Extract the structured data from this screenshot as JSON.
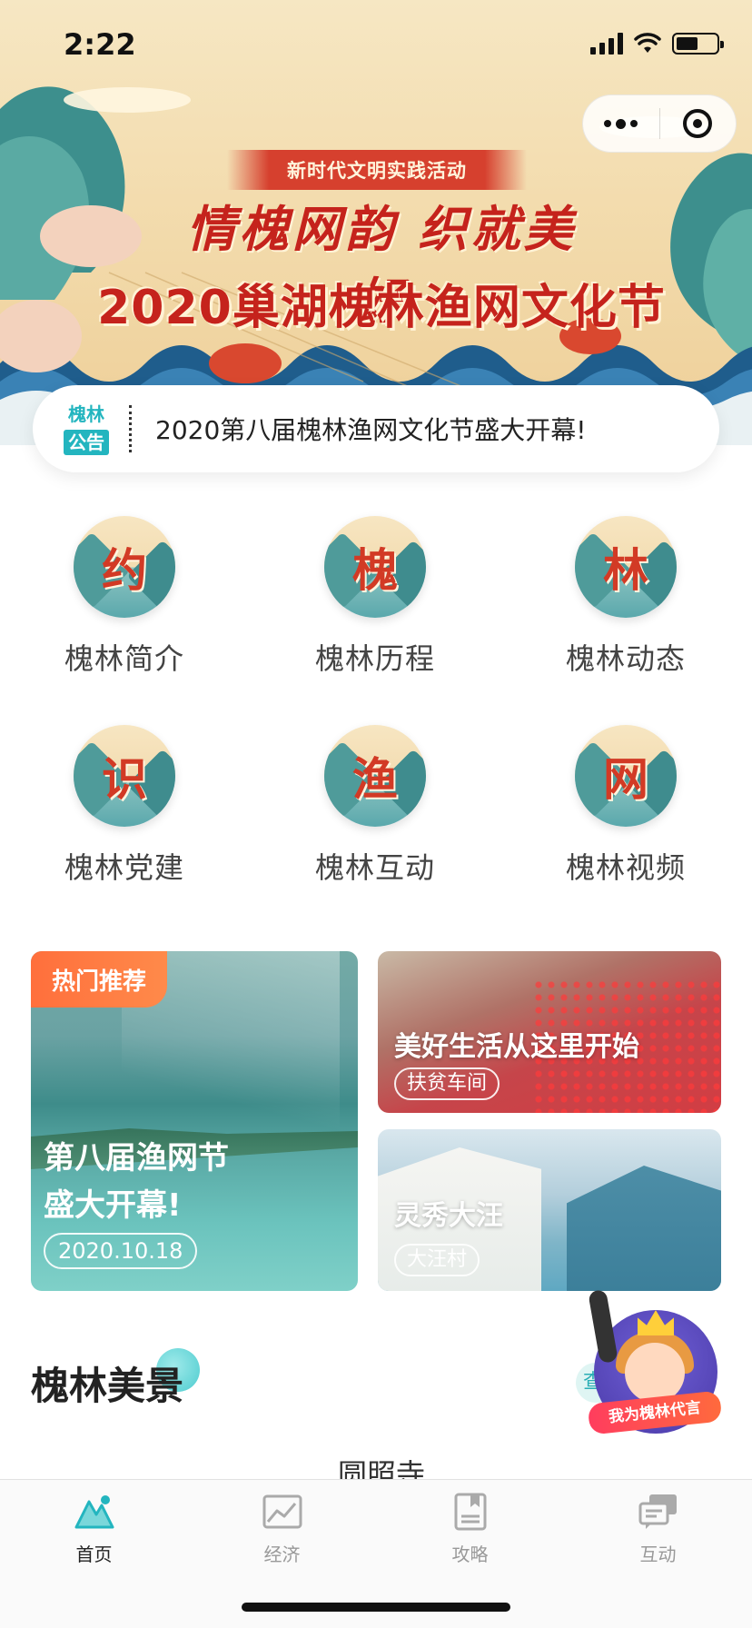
{
  "status_bar": {
    "time": "2:22"
  },
  "hero": {
    "ribbon": "新时代文明实践活动",
    "calligraphy": "情槐网韵 织就美好",
    "title": "2020巢湖槐林渔网文化节"
  },
  "notice": {
    "logo_top": "槐林",
    "logo_bottom": "公告",
    "text": "2020第八届槐林渔网文化节盛大开幕!"
  },
  "nav": [
    {
      "glyph": "约",
      "label": "槐林简介"
    },
    {
      "glyph": "槐",
      "label": "槐林历程"
    },
    {
      "glyph": "林",
      "label": "槐林动态"
    },
    {
      "glyph": "识",
      "label": "槐林党建"
    },
    {
      "glyph": "渔",
      "label": "槐林互动"
    },
    {
      "glyph": "网",
      "label": "槐林视频"
    }
  ],
  "cards": {
    "hot": {
      "tag": "热门推荐",
      "title_line1": "第八届渔网节",
      "title_line2": "盛大开幕!",
      "date": "2020.10.18"
    },
    "factory": {
      "title": "美好生活从这里开始",
      "tag": "扶贫车间"
    },
    "village": {
      "title": "灵秀大汪",
      "tag": "大汪村"
    }
  },
  "section": {
    "title": "槐林美景",
    "more": "查",
    "peek": "圆照寺"
  },
  "mascot": {
    "banner": "我为槐林代言"
  },
  "tabs": [
    {
      "label": "首页",
      "icon": "mountain-icon",
      "active": true
    },
    {
      "label": "经济",
      "icon": "chart-icon",
      "active": false
    },
    {
      "label": "攻略",
      "icon": "book-icon",
      "active": false
    },
    {
      "label": "互动",
      "icon": "chat-icon",
      "active": false
    }
  ],
  "colors": {
    "accent": "#23b5bf",
    "hero_red": "#c5231c",
    "hot_tag": "#ff7a45"
  }
}
